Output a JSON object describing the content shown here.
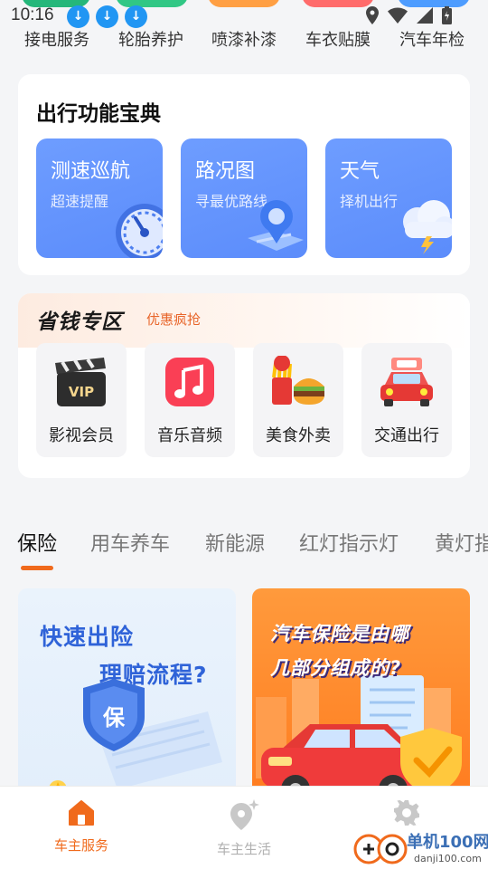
{
  "status_bar": {
    "time": "10:16"
  },
  "service_row": [
    "接电服务",
    "轮胎养护",
    "喷漆补漆",
    "车衣贴膜",
    "汽车年检"
  ],
  "travel_functions": {
    "title": "出行功能宝典",
    "items": [
      {
        "name": "测速巡航",
        "sub": "超速提醒",
        "icon": "speedometer-icon"
      },
      {
        "name": "路况图",
        "sub": "寻最优路线",
        "icon": "map-pin-icon"
      },
      {
        "name": "天气",
        "sub": "择机出行",
        "icon": "weather-cloud-icon"
      }
    ]
  },
  "save_zone": {
    "title": "省钱专区",
    "subtitle": "优惠疯抢",
    "items": [
      {
        "label": "影视会员",
        "icon": "clapperboard-vip-icon",
        "badge": "VIP"
      },
      {
        "label": "音乐音频",
        "icon": "music-note-icon"
      },
      {
        "label": "美食外卖",
        "icon": "burger-fries-icon"
      },
      {
        "label": "交通出行",
        "icon": "car-icon"
      }
    ]
  },
  "tabs": [
    "保险",
    "用车养车",
    "新能源",
    "红灯指示灯",
    "黄灯指"
  ],
  "articles": [
    {
      "line1": "快速出险",
      "line2": "理赔流程?",
      "badge_char": "保"
    },
    {
      "line1": "汽车保险是由哪",
      "line2": "几部分组成的?"
    }
  ],
  "bottom_nav": [
    {
      "label": "车主服务",
      "icon": "home-icon"
    },
    {
      "label": "车主生活",
      "icon": "location-sparkle-icon"
    },
    {
      "label": "",
      "icon": "gear-icon"
    }
  ],
  "watermark": {
    "text": "单机100网",
    "url": "danji100.com"
  },
  "colors": {
    "accent": "#f06a1c",
    "tile_blue": "#5b8cfb",
    "page_bg": "#f4f5f7",
    "download_blue": "#2196f3"
  }
}
